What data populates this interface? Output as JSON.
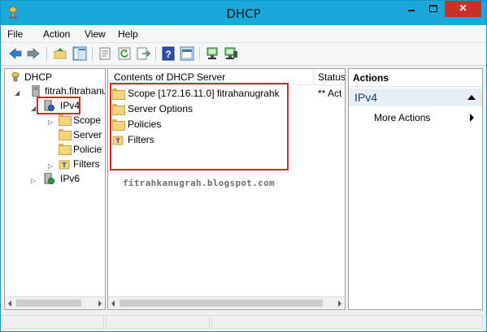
{
  "window": {
    "title": "DHCP",
    "minimize_icon": "minimize-icon",
    "maximize_icon": "maximize-icon",
    "close_label": "✕"
  },
  "menu": {
    "items": [
      "File",
      "Action",
      "View",
      "Help"
    ]
  },
  "toolbar": {
    "buttons": [
      "back-arrow-icon",
      "forward-arrow-icon",
      "up-folder-icon",
      "show-hide-tree-icon",
      "properties-icon",
      "refresh-icon",
      "export-list-icon",
      "help-icon",
      "show-hide-action-pane-icon",
      "server-icon",
      "server-authorize-icon"
    ]
  },
  "tree": {
    "root": "DHCP",
    "server": "fitrah.fitrahanu",
    "ipv4": "IPv4",
    "children": [
      "Scope",
      "Server",
      "Policie",
      "Filters"
    ],
    "ipv6": "IPv6"
  },
  "center": {
    "columns": [
      "Contents of DHCP Server",
      "Status"
    ],
    "rows": [
      {
        "name": "Scope [172.16.11.0] fitrahanugrahk",
        "status": "** Act"
      },
      {
        "name": "Server Options",
        "status": ""
      },
      {
        "name": "Policies",
        "status": ""
      },
      {
        "name": "Filters",
        "status": ""
      }
    ],
    "watermark": "fitrahkanugrah.blogspot.com"
  },
  "actions": {
    "title": "Actions",
    "group": "IPv4",
    "items": [
      "More Actions"
    ]
  },
  "colors": {
    "titlebar": "#1aa7d9",
    "close_button": "#c7312c",
    "highlight_box": "#d9262b",
    "actions_group_bg": "#e7eef6"
  }
}
